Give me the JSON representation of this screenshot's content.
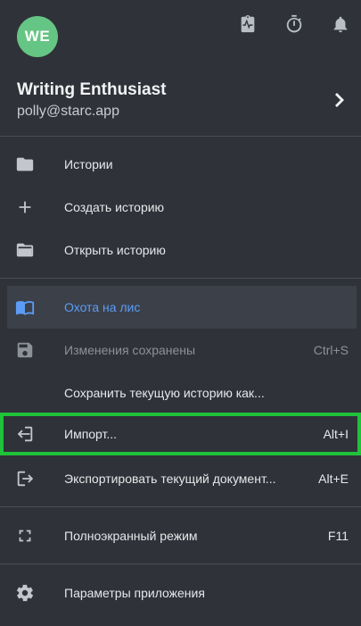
{
  "header": {
    "avatar_initials": "WE",
    "avatar_color": "#65c584",
    "icons": [
      "clipboard-pulse-icon",
      "timer-icon",
      "bell-icon"
    ]
  },
  "profile": {
    "name": "Writing Enthusiast",
    "email": "polly@starc.app"
  },
  "menu": {
    "stories": {
      "label": "Истории",
      "icon": "folder-icon"
    },
    "create_story": {
      "label": "Создать историю",
      "icon": "plus-icon"
    },
    "open_story": {
      "label": "Открыть историю",
      "icon": "folder-open-icon"
    },
    "current_story": {
      "label": "Охота на лис",
      "icon": "book-open-icon",
      "active": true
    },
    "save": {
      "label": "Изменения сохранены",
      "shortcut": "Ctrl+S",
      "icon": "save-icon",
      "disabled": true
    },
    "save_as": {
      "label": "Сохранить текущую историю как..."
    },
    "import": {
      "label": "Импорт...",
      "shortcut": "Alt+I",
      "icon": "import-icon"
    },
    "export": {
      "label": "Экспортировать текущий документ...",
      "shortcut": "Alt+E",
      "icon": "export-icon"
    },
    "fullscreen": {
      "label": "Полноэкранный режим",
      "shortcut": "F11",
      "icon": "fullscreen-icon"
    },
    "settings": {
      "label": "Параметры приложения",
      "icon": "gear-icon"
    }
  },
  "colors": {
    "background": "#2f3238",
    "active_background": "#3b4049",
    "accent": "#5c9cf5",
    "highlight_outline": "#1fc23a"
  }
}
